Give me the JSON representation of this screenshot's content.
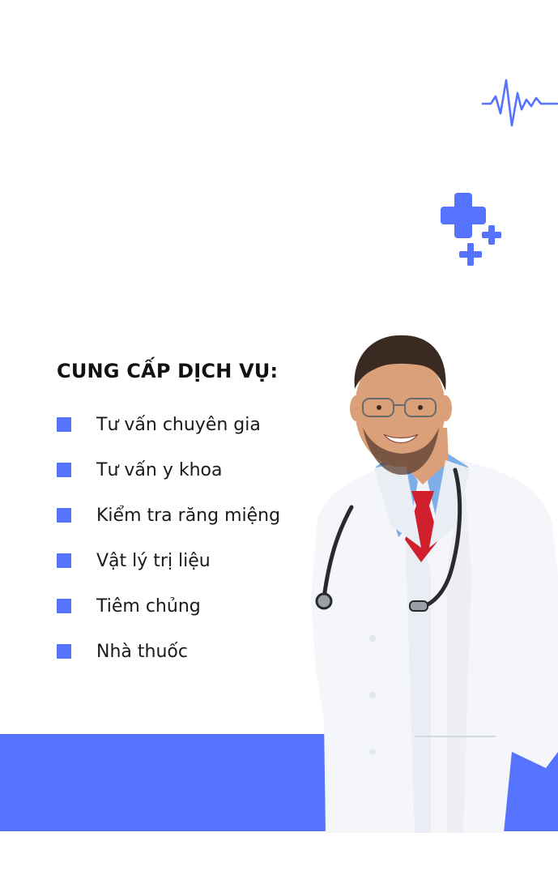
{
  "services": {
    "title": "CUNG CẤP DỊCH VỤ:",
    "items": [
      "Tư vấn chuyên gia",
      "Tư vấn y khoa",
      "Kiểm tra răng miệng",
      "Vật lý trị liệu",
      "Tiêm chủng",
      "Nhà thuốc"
    ]
  },
  "colors": {
    "accent": "#5573FF",
    "title": "#111111",
    "coat": "#F4F6FA",
    "shirt": "#7DAEE8",
    "tie": "#D0202E",
    "skin": "#D9A07A",
    "hair": "#3A2A22"
  },
  "icons": [
    "heartbeat-icon",
    "medical-cross-icon"
  ]
}
